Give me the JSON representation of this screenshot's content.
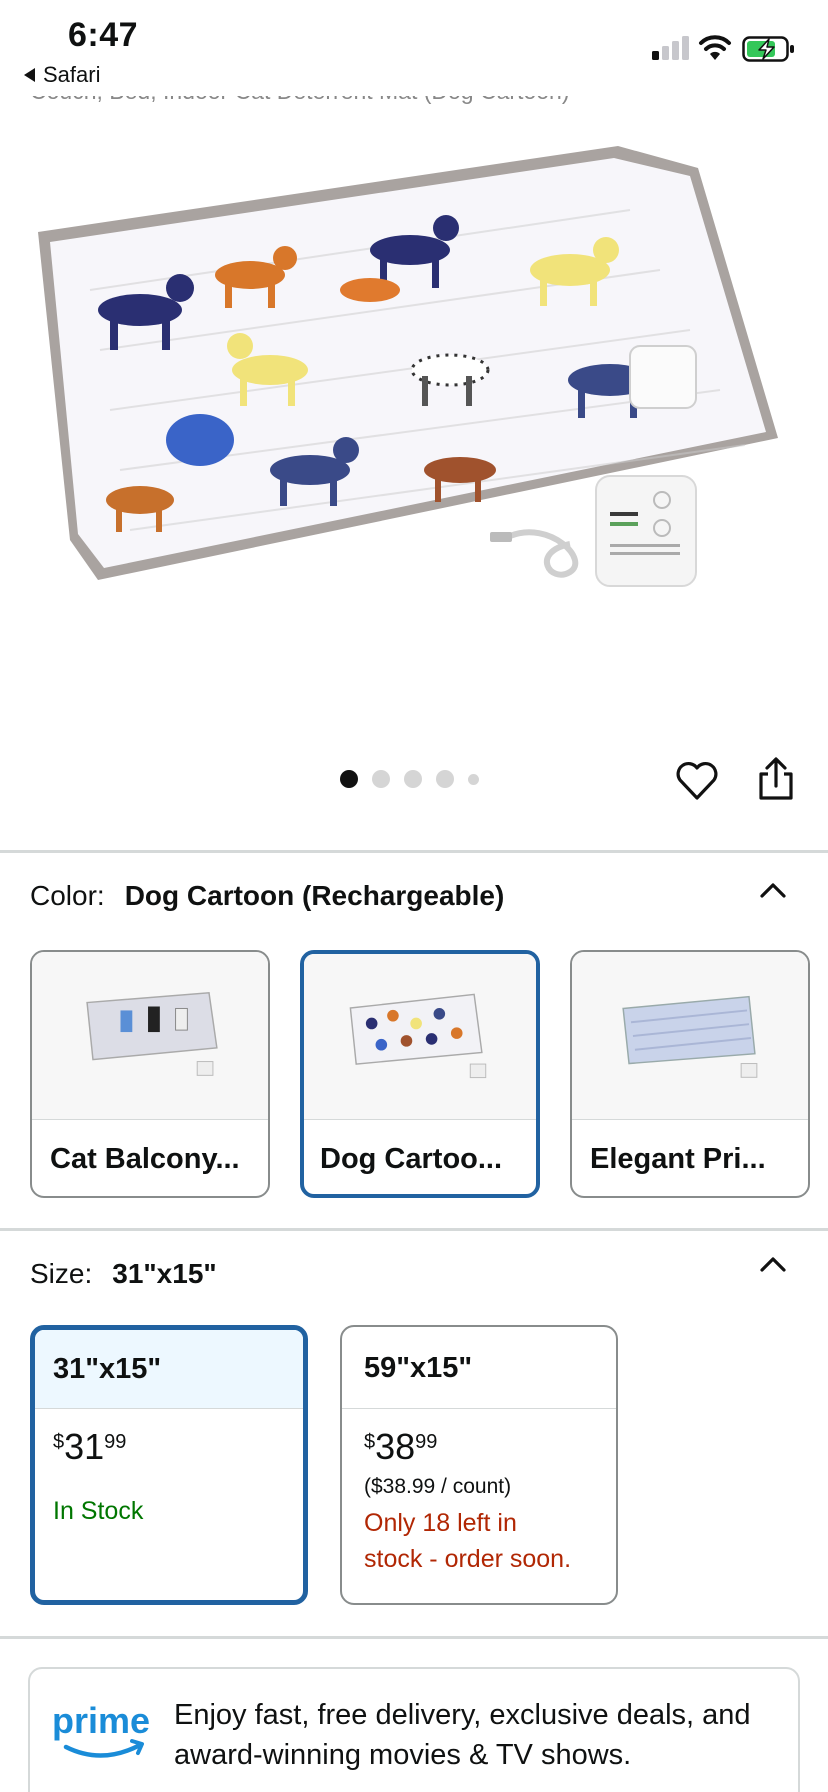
{
  "status_bar": {
    "time": "6:47",
    "back_app": "Safari",
    "icons": [
      "signal-icon",
      "wifi-icon",
      "battery-charging-icon"
    ]
  },
  "product": {
    "title_fragment": "Couch, Bed, Indoor Cat Deterrent Mat (Dog Cartoon)",
    "image_count": 5,
    "active_image_index": 0
  },
  "color": {
    "label": "Color:",
    "selected": "Dog Cartoon (Rechargeable)",
    "options": [
      {
        "label": "Cat Balcony..."
      },
      {
        "label": "Dog Cartoo..."
      },
      {
        "label": "Elegant Pri..."
      }
    ],
    "selected_index": 1
  },
  "size": {
    "label": "Size:",
    "selected": "31\"x15\"",
    "options": [
      {
        "name": "31\"x15\"",
        "price_symbol": "$",
        "price_whole": "31",
        "price_fraction": "99",
        "availability": "In Stock"
      },
      {
        "name": "59\"x15\"",
        "price_symbol": "$",
        "price_whole": "38",
        "price_fraction": "99",
        "unit_price": "($38.99 / count)",
        "availability_line1": "Only 18 left in",
        "availability_line2": "stock - order soon."
      }
    ]
  },
  "prime": {
    "logo_text": "prime",
    "text": "Enjoy fast, free delivery, exclusive deals, and award-winning movies & TV shows."
  },
  "colors": {
    "selected_border": "#2162a1",
    "in_stock": "#007600",
    "low_stock": "#b12704",
    "prime_blue": "#1a8cd8"
  }
}
